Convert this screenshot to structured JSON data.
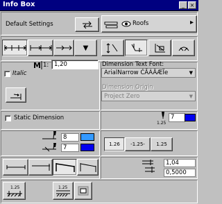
{
  "window": {
    "title": "Info Box"
  },
  "top": {
    "default_settings": "Default Settings",
    "layer_label": "Roofs",
    "layer_arrow": "▸"
  },
  "style_tabs": {
    "arrow_down": "▼"
  },
  "text": {
    "size_label": "1:",
    "size_value": "1,20",
    "italic_label": "Italic",
    "font_label": "Dimension Text Font:",
    "font_value": "ArialNarrow ĆĂÁÄÆÏe",
    "origin_label": "Dimension Origin",
    "origin_value": "Project Zero",
    "static_label": "Static Dimension",
    "pen_value": "7",
    "pen_scale": "1.25"
  },
  "pens": {
    "pen1_value": "8",
    "pen2_value": "7"
  },
  "format": {
    "btn1": "1.26",
    "btn2": "-1.25-",
    "btn3": "1.25"
  },
  "extension": {
    "value1": "1,04",
    "value2": "0,5000"
  },
  "bottom": {
    "label1": "1.25",
    "label2": "1.25"
  },
  "colors": {
    "pen_light": "#3399ff",
    "pen_dark": "#0000ee",
    "title": "#000080"
  }
}
